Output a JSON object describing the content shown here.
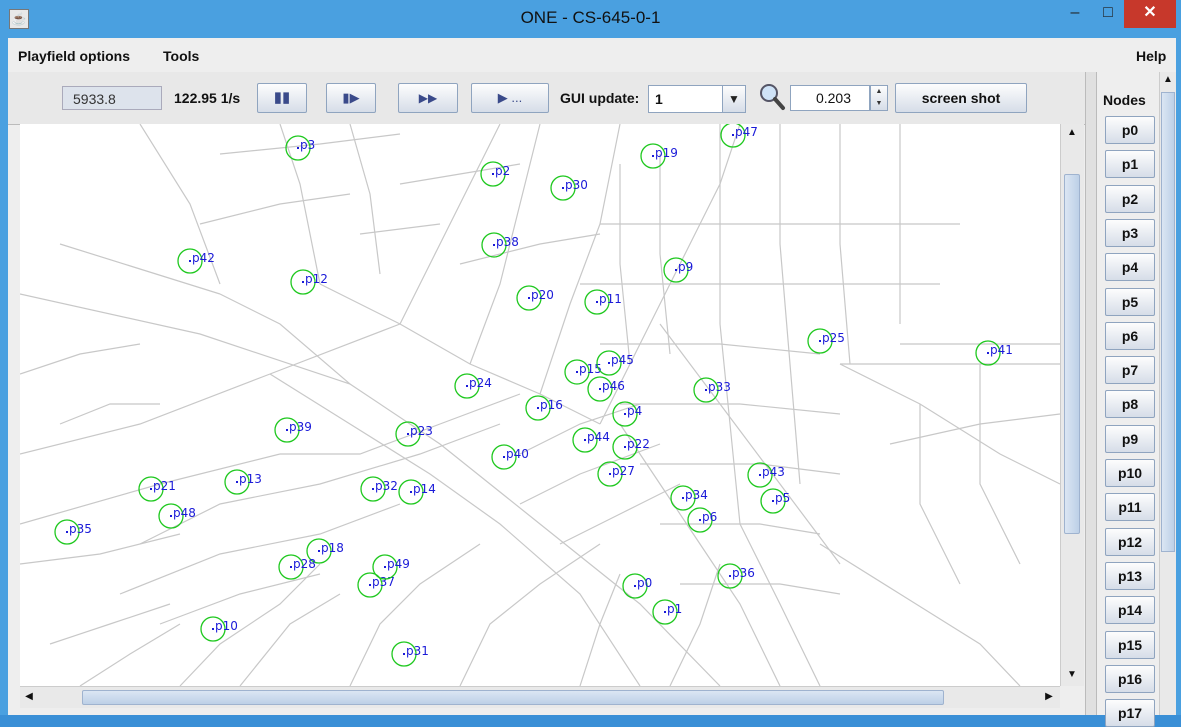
{
  "window": {
    "title": "ONE - CS-645-0-1",
    "minimize_glyph": "–",
    "maximize_glyph": "□",
    "close_glyph": "✕"
  },
  "menu": {
    "playfield_options": "Playfield options",
    "tools": "Tools",
    "help": "Help"
  },
  "toolbar": {
    "sim_time": "5933.8",
    "speed": "122.95 1/s",
    "pause_glyph": "▮▮",
    "step_glyph": "▮▶",
    "fast_forward_glyph": "▶▶",
    "play_until_glyph": "▶ ...",
    "gui_update_label": "GUI update:",
    "gui_update_value": "1",
    "zoom_value": "0.203",
    "screenshot_label": "screen shot"
  },
  "nodes_panel": {
    "title": "Nodes",
    "items": [
      "p0",
      "p1",
      "p2",
      "p3",
      "p4",
      "p5",
      "p6",
      "p7",
      "p8",
      "p9",
      "p10",
      "p11",
      "p12",
      "p13",
      "p14",
      "p15",
      "p16",
      "p17"
    ]
  },
  "map_nodes": [
    {
      "label": "p0"
    },
    {
      "label": "p1"
    },
    {
      "label": "p2"
    },
    {
      "label": "p3"
    },
    {
      "label": "p4"
    },
    {
      "label": "p5"
    },
    {
      "label": "p6"
    },
    {
      "label": "p9"
    },
    {
      "label": "p10"
    },
    {
      "label": "p11"
    },
    {
      "label": "p12"
    },
    {
      "label": "p13"
    },
    {
      "label": "p14"
    },
    {
      "label": "p15"
    },
    {
      "label": "p16"
    },
    {
      "label": "p18"
    },
    {
      "label": "p19"
    },
    {
      "label": "p20"
    },
    {
      "label": "p21"
    },
    {
      "label": "p22"
    },
    {
      "label": "p23"
    },
    {
      "label": "p24"
    },
    {
      "label": "p25"
    },
    {
      "label": "p27"
    },
    {
      "label": "p28"
    },
    {
      "label": "p30"
    },
    {
      "label": "p31"
    },
    {
      "label": "p32"
    },
    {
      "label": "p33"
    },
    {
      "label": "p34"
    },
    {
      "label": "p35"
    },
    {
      "label": "p36"
    },
    {
      "label": "p37"
    },
    {
      "label": "p38"
    },
    {
      "label": "p39"
    },
    {
      "label": "p40"
    },
    {
      "label": "p41"
    },
    {
      "label": "p42"
    },
    {
      "label": "p43"
    },
    {
      "label": "p44"
    },
    {
      "label": "p45"
    },
    {
      "label": "p46"
    },
    {
      "label": "p47"
    },
    {
      "label": "p48"
    },
    {
      "label": "p49"
    }
  ],
  "colors": {
    "node_circle": "#1ec81e",
    "node_label": "#1a1ad8",
    "road": "#c8c8c8",
    "close_button": "#c7382b"
  }
}
